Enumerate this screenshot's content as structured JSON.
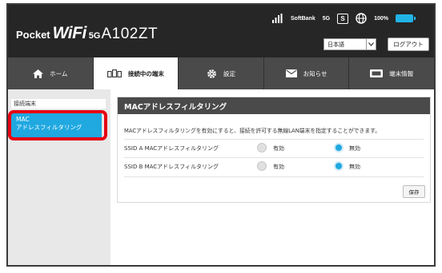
{
  "header": {
    "logo": {
      "pocket": "Pocket",
      "wifi": "WiFi",
      "g5": "5G",
      "model": "A102ZT"
    },
    "status": {
      "carrier": "SoftBank",
      "network": "5G",
      "sim_label": "S",
      "battery_text": "100%"
    },
    "language": {
      "selected": "日本語"
    },
    "logout_label": "ログアウト"
  },
  "nav": {
    "tabs": [
      {
        "label": "ホーム",
        "icon": "home-icon"
      },
      {
        "label": "接続中の端末",
        "icon": "devices-icon",
        "active": true
      },
      {
        "label": "設定",
        "icon": "gear-icon"
      },
      {
        "label": "お知らせ",
        "icon": "mail-icon"
      },
      {
        "label": "端末情報",
        "icon": "device-info-icon"
      }
    ]
  },
  "sidebar": {
    "header": "接続端末",
    "items": [
      {
        "line1": "MAC",
        "line2": "アドレスフィルタリング",
        "active": true
      }
    ]
  },
  "panel": {
    "title": "MACアドレスフィルタリング",
    "description": "MACアドレスフィルタリングを有効にすると、接続を許可する無線LAN端末を指定することができます。",
    "rows": [
      {
        "label": "SSID A MACアドレスフィルタリング",
        "enable_label": "有効",
        "disable_label": "無効",
        "selected": "disable"
      },
      {
        "label": "SSID B MACアドレスフィルタリング",
        "enable_label": "有効",
        "disable_label": "無効",
        "selected": "disable"
      }
    ],
    "save_label": "保存"
  },
  "colors": {
    "accent": "#20a8e0",
    "header_bg": "#262626",
    "nav_bg": "#4a4a4a",
    "highlight": "#e60012"
  }
}
